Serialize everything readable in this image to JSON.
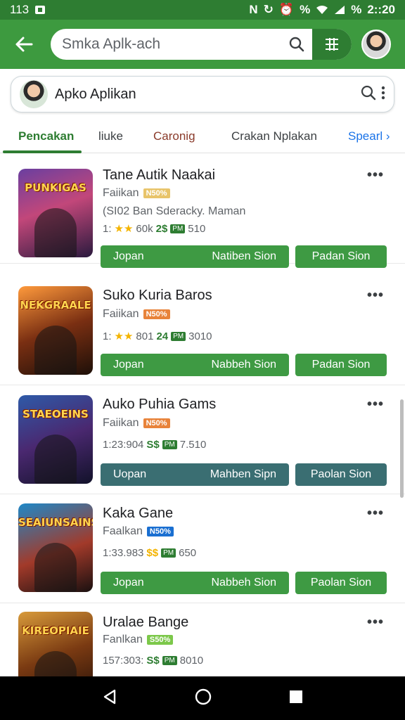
{
  "status_bar": {
    "left": "113",
    "time": "2::20"
  },
  "search": {
    "placeholder": "Smka Aplk-ach"
  },
  "app_card": {
    "title": "Apko Aplikan"
  },
  "tabs": [
    {
      "label": "Pencakan",
      "active": true
    },
    {
      "label": "liuke"
    },
    {
      "label": "Caronig"
    },
    {
      "label": "Crakan  Nplakan"
    },
    {
      "label": "Spearl ›"
    }
  ],
  "colors": {
    "primary": "#3d9a3f",
    "dark": "#2e7d32",
    "teal": "#3a6e72"
  },
  "items": [
    {
      "title": "Tane Autik Naakai",
      "dev": "Faiikan",
      "badge": "N50%",
      "badge_color": "#e8c46a",
      "desc": "(SI02 Ban Sderacky. Maman",
      "rating": "1:",
      "stars": "★★",
      "downloads": "60k",
      "price": "2$",
      "tag": "PM",
      "size": "510",
      "btn_left": "Jopan",
      "btn_mid": "Natiben Sion",
      "btn_right": "Padan Sion",
      "thumb_label": "PUNKIGAS",
      "thumb_bg": "linear-gradient(160deg,#6a3fa0,#c2477a 45%,#2a1a3e)",
      "btn_color": "green"
    },
    {
      "title": "Suko Kuria Baros",
      "dev": "Faiikan",
      "badge": "N50%",
      "badge_color": "#e8833a",
      "desc": "",
      "rating": "1:",
      "stars": "★★",
      "downloads": "801",
      "price": "24",
      "tag": "PM",
      "size": "3010",
      "btn_left": "Jopan",
      "btn_mid": "Nabbeh Sion",
      "btn_right": "Padan Sion",
      "thumb_label": "NEKGRAALE",
      "thumb_bg": "linear-gradient(160deg,#ff9a3c,#7a2f12 50%,#1d0f08)",
      "btn_color": "green"
    },
    {
      "title": "Auko Puhia Gams",
      "dev": "Faiikan",
      "badge": "N50%",
      "badge_color": "#e8833a",
      "desc": "",
      "rating": "1:23:904",
      "stars": "",
      "downloads": "",
      "price": "S$",
      "tag": "PM",
      "size": "7.510",
      "btn_left": "Uopan",
      "btn_mid": "Mahben Sipn",
      "btn_right": "Paolan Sion",
      "thumb_label": "STAEOEINS",
      "thumb_bg": "linear-gradient(160deg,#2e5aa8,#4a2870 50%,#12122a)",
      "btn_color": "teal"
    },
    {
      "title": "Kaka Gane",
      "dev": "Faalkan",
      "badge": "N50%",
      "badge_color": "#1a6fd1",
      "desc": "",
      "rating": "1:33.983",
      "stars": "",
      "downloads": "",
      "price": "$$",
      "tag": "PM",
      "size": "650",
      "btn_left": "Jopan",
      "btn_mid": "Nabbeh Sion",
      "btn_right": "Paolan Sion",
      "thumb_label": "SEAIUNSAINS",
      "thumb_bg": "linear-gradient(160deg,#1e88c8,#a23a2a 55%,#1a1010)",
      "btn_color": "green"
    },
    {
      "title": "Uralae Bange",
      "dev": "Fanlkan",
      "badge": "S50%",
      "badge_color": "#7cc84a",
      "desc": "",
      "rating": "157:303:",
      "stars": "",
      "downloads": "",
      "price": "S$",
      "tag": "PM",
      "size": "8010",
      "btn_left": "",
      "btn_mid": "",
      "btn_right": "",
      "thumb_label": "KIREOPIAIE",
      "thumb_bg": "linear-gradient(160deg,#d89a3a,#7a3a12 50%,#241008)",
      "btn_color": "green"
    }
  ]
}
